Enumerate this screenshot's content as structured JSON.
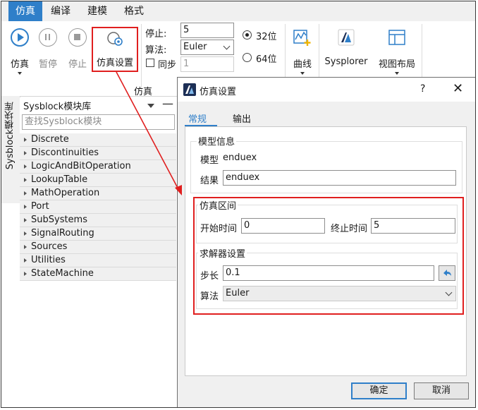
{
  "menu": {
    "tabs": [
      "仿真",
      "编译",
      "建模",
      "格式"
    ],
    "active": 0
  },
  "ribbon": {
    "simulate": "仿真",
    "pause": "暂停",
    "stop": "停止",
    "sim_settings": "仿真设置",
    "stop_time_label": "停止:",
    "stop_time_value": "5",
    "algorithm_label": "算法:",
    "algorithm_value": "Euler",
    "sync_label": "同步",
    "sync_value": "1",
    "bit32": "32位",
    "bit64": "64位",
    "curve": "曲线",
    "sysplorer": "Sysplorer",
    "view_layout": "视图布局",
    "group_caption": "仿真"
  },
  "sidebar": {
    "vtab": "Sysblock模块库",
    "title": "Sysblock模块库",
    "search_placeholder": "查找Sysblock模块",
    "items": [
      "Discrete",
      "Discontinuities",
      "LogicAndBitOperation",
      "LookupTable",
      "MathOperation",
      "Port",
      "SubSystems",
      "SignalRouting",
      "Sources",
      "Utilities",
      "StateMachine"
    ]
  },
  "dialog": {
    "title": "仿真设置",
    "help": "?",
    "close": "✕",
    "tabs": [
      "常规",
      "输出"
    ],
    "model_info": {
      "title": "模型信息",
      "model_label": "模型",
      "model_value": "enduex",
      "result_label": "结果",
      "result_value": "enduex"
    },
    "interval": {
      "title": "仿真区间",
      "start_label": "开始时间",
      "start_value": "0",
      "end_label": "终止时间",
      "end_value": "5"
    },
    "solver": {
      "title": "求解器设置",
      "step_label": "步长",
      "step_value": "0.1",
      "algo_label": "算法",
      "algo_value": "Euler"
    },
    "ok": "确定",
    "cancel": "取消"
  },
  "colors": {
    "accent": "#2f7fc9",
    "highlight": "#e01f1f",
    "logo": "#1d2f56"
  }
}
